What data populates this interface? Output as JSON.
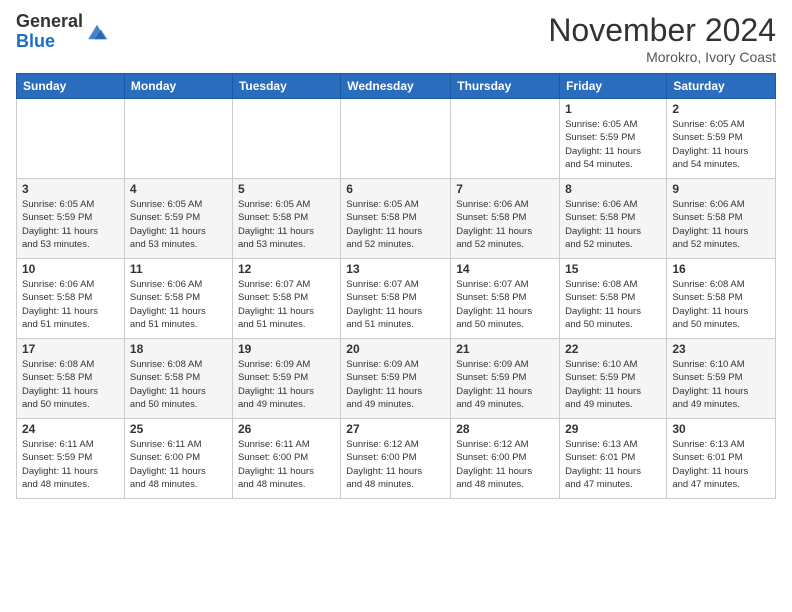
{
  "header": {
    "logo_line1": "General",
    "logo_line2": "Blue",
    "month": "November 2024",
    "location": "Morokro, Ivory Coast"
  },
  "weekdays": [
    "Sunday",
    "Monday",
    "Tuesday",
    "Wednesday",
    "Thursday",
    "Friday",
    "Saturday"
  ],
  "weeks": [
    [
      {
        "day": "",
        "info": ""
      },
      {
        "day": "",
        "info": ""
      },
      {
        "day": "",
        "info": ""
      },
      {
        "day": "",
        "info": ""
      },
      {
        "day": "",
        "info": ""
      },
      {
        "day": "1",
        "info": "Sunrise: 6:05 AM\nSunset: 5:59 PM\nDaylight: 11 hours\nand 54 minutes."
      },
      {
        "day": "2",
        "info": "Sunrise: 6:05 AM\nSunset: 5:59 PM\nDaylight: 11 hours\nand 54 minutes."
      }
    ],
    [
      {
        "day": "3",
        "info": "Sunrise: 6:05 AM\nSunset: 5:59 PM\nDaylight: 11 hours\nand 53 minutes."
      },
      {
        "day": "4",
        "info": "Sunrise: 6:05 AM\nSunset: 5:59 PM\nDaylight: 11 hours\nand 53 minutes."
      },
      {
        "day": "5",
        "info": "Sunrise: 6:05 AM\nSunset: 5:58 PM\nDaylight: 11 hours\nand 53 minutes."
      },
      {
        "day": "6",
        "info": "Sunrise: 6:05 AM\nSunset: 5:58 PM\nDaylight: 11 hours\nand 52 minutes."
      },
      {
        "day": "7",
        "info": "Sunrise: 6:06 AM\nSunset: 5:58 PM\nDaylight: 11 hours\nand 52 minutes."
      },
      {
        "day": "8",
        "info": "Sunrise: 6:06 AM\nSunset: 5:58 PM\nDaylight: 11 hours\nand 52 minutes."
      },
      {
        "day": "9",
        "info": "Sunrise: 6:06 AM\nSunset: 5:58 PM\nDaylight: 11 hours\nand 52 minutes."
      }
    ],
    [
      {
        "day": "10",
        "info": "Sunrise: 6:06 AM\nSunset: 5:58 PM\nDaylight: 11 hours\nand 51 minutes."
      },
      {
        "day": "11",
        "info": "Sunrise: 6:06 AM\nSunset: 5:58 PM\nDaylight: 11 hours\nand 51 minutes."
      },
      {
        "day": "12",
        "info": "Sunrise: 6:07 AM\nSunset: 5:58 PM\nDaylight: 11 hours\nand 51 minutes."
      },
      {
        "day": "13",
        "info": "Sunrise: 6:07 AM\nSunset: 5:58 PM\nDaylight: 11 hours\nand 51 minutes."
      },
      {
        "day": "14",
        "info": "Sunrise: 6:07 AM\nSunset: 5:58 PM\nDaylight: 11 hours\nand 50 minutes."
      },
      {
        "day": "15",
        "info": "Sunrise: 6:08 AM\nSunset: 5:58 PM\nDaylight: 11 hours\nand 50 minutes."
      },
      {
        "day": "16",
        "info": "Sunrise: 6:08 AM\nSunset: 5:58 PM\nDaylight: 11 hours\nand 50 minutes."
      }
    ],
    [
      {
        "day": "17",
        "info": "Sunrise: 6:08 AM\nSunset: 5:58 PM\nDaylight: 11 hours\nand 50 minutes."
      },
      {
        "day": "18",
        "info": "Sunrise: 6:08 AM\nSunset: 5:58 PM\nDaylight: 11 hours\nand 50 minutes."
      },
      {
        "day": "19",
        "info": "Sunrise: 6:09 AM\nSunset: 5:59 PM\nDaylight: 11 hours\nand 49 minutes."
      },
      {
        "day": "20",
        "info": "Sunrise: 6:09 AM\nSunset: 5:59 PM\nDaylight: 11 hours\nand 49 minutes."
      },
      {
        "day": "21",
        "info": "Sunrise: 6:09 AM\nSunset: 5:59 PM\nDaylight: 11 hours\nand 49 minutes."
      },
      {
        "day": "22",
        "info": "Sunrise: 6:10 AM\nSunset: 5:59 PM\nDaylight: 11 hours\nand 49 minutes."
      },
      {
        "day": "23",
        "info": "Sunrise: 6:10 AM\nSunset: 5:59 PM\nDaylight: 11 hours\nand 49 minutes."
      }
    ],
    [
      {
        "day": "24",
        "info": "Sunrise: 6:11 AM\nSunset: 5:59 PM\nDaylight: 11 hours\nand 48 minutes."
      },
      {
        "day": "25",
        "info": "Sunrise: 6:11 AM\nSunset: 6:00 PM\nDaylight: 11 hours\nand 48 minutes."
      },
      {
        "day": "26",
        "info": "Sunrise: 6:11 AM\nSunset: 6:00 PM\nDaylight: 11 hours\nand 48 minutes."
      },
      {
        "day": "27",
        "info": "Sunrise: 6:12 AM\nSunset: 6:00 PM\nDaylight: 11 hours\nand 48 minutes."
      },
      {
        "day": "28",
        "info": "Sunrise: 6:12 AM\nSunset: 6:00 PM\nDaylight: 11 hours\nand 48 minutes."
      },
      {
        "day": "29",
        "info": "Sunrise: 6:13 AM\nSunset: 6:01 PM\nDaylight: 11 hours\nand 47 minutes."
      },
      {
        "day": "30",
        "info": "Sunrise: 6:13 AM\nSunset: 6:01 PM\nDaylight: 11 hours\nand 47 minutes."
      }
    ]
  ]
}
